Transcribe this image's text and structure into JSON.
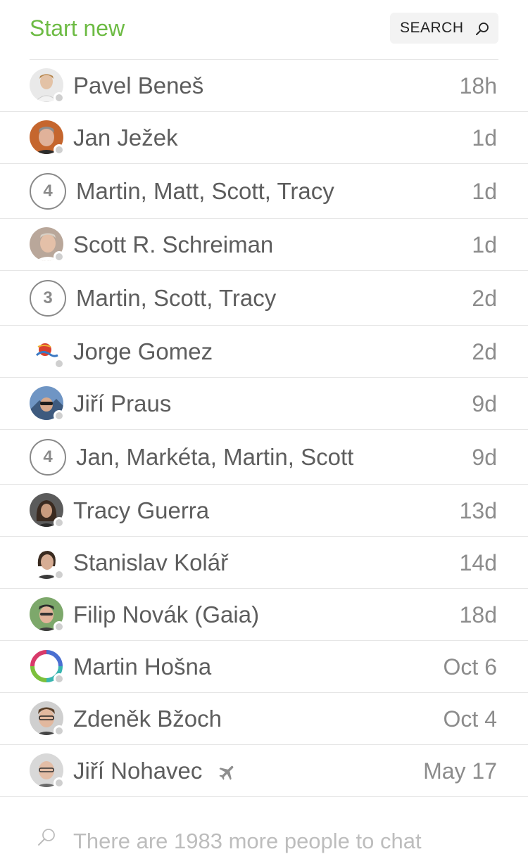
{
  "header": {
    "start_new_label": "Start new",
    "search_label": "SEARCH"
  },
  "colors": {
    "accent": "#6dbb44",
    "status_offline": "#cfcfcf",
    "divider": "#e6e6e6"
  },
  "conversations": [
    {
      "name": "Pavel Beneš",
      "time": "18h",
      "kind": "person",
      "avatar": "avatar-pavel"
    },
    {
      "name": "Jan Ježek",
      "time": "1d",
      "kind": "person",
      "avatar": "avatar-jan"
    },
    {
      "name": "Martin, Matt, Scott, Tracy",
      "time": "1d",
      "kind": "group",
      "count": "4"
    },
    {
      "name": "Scott R. Schreiman",
      "time": "1d",
      "kind": "person",
      "avatar": "avatar-scott"
    },
    {
      "name": "Martin, Scott, Tracy",
      "time": "2d",
      "kind": "group",
      "count": "3"
    },
    {
      "name": "Jorge Gomez",
      "time": "2d",
      "kind": "person",
      "avatar": "avatar-jorge-logo"
    },
    {
      "name": "Jiří Praus",
      "time": "9d",
      "kind": "person",
      "avatar": "avatar-jiri-praus"
    },
    {
      "name": "Jan, Markéta, Martin, Scott",
      "time": "9d",
      "kind": "group",
      "count": "4"
    },
    {
      "name": "Tracy Guerra",
      "time": "13d",
      "kind": "person",
      "avatar": "avatar-tracy"
    },
    {
      "name": "Stanislav Kolář",
      "time": "14d",
      "kind": "person",
      "avatar": "avatar-stanislav"
    },
    {
      "name": "Filip Novák (Gaia)",
      "time": "18d",
      "kind": "person",
      "avatar": "avatar-filip"
    },
    {
      "name": "Martin Hošna",
      "time": "Oct 6",
      "kind": "person",
      "avatar": "avatar-martin-ring"
    },
    {
      "name": "Zdeněk Bžoch",
      "time": "Oct 4",
      "kind": "person",
      "avatar": "avatar-zdenek"
    },
    {
      "name": "Jiří Nohavec",
      "time": "May 17",
      "kind": "person",
      "avatar": "avatar-jiri-nohavec",
      "extra_icon": "airplane-icon"
    }
  ],
  "footer": {
    "icon": "search-icon",
    "text": "There are 1983 more people to chat"
  }
}
